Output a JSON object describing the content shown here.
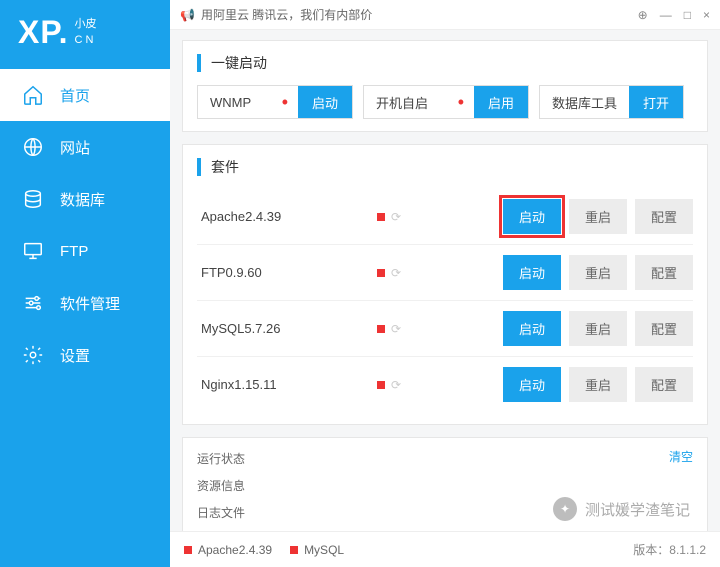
{
  "logo": {
    "main": "XP.",
    "sub1": "小皮",
    "sub2": "C N"
  },
  "topbar": {
    "announce": "用阿里云 腾讯云，我们有内部价",
    "pin": "⊕",
    "min": "—",
    "max": "□",
    "close": "×"
  },
  "sidebar": {
    "items": [
      {
        "label": "首页"
      },
      {
        "label": "网站"
      },
      {
        "label": "数据库"
      },
      {
        "label": "FTP"
      },
      {
        "label": "软件管理"
      },
      {
        "label": "设置"
      }
    ]
  },
  "quick": {
    "title": "一键启动",
    "wnmp": {
      "label": "WNMP",
      "btn": "启动"
    },
    "boot": {
      "label": "开机自启",
      "btn": "启用"
    },
    "db": {
      "label": "数据库工具",
      "btn": "打开"
    }
  },
  "suite": {
    "title": "套件",
    "btn_start": "启动",
    "btn_restart": "重启",
    "btn_config": "配置",
    "rows": [
      {
        "name": "Apache2.4.39"
      },
      {
        "name": "FTP0.9.60"
      },
      {
        "name": "MySQL5.7.26"
      },
      {
        "name": "Nginx1.15.11"
      }
    ]
  },
  "panel": {
    "tabs": [
      "运行状态",
      "资源信息",
      "日志文件"
    ],
    "clear": "清空"
  },
  "footer": {
    "items": [
      "Apache2.4.39",
      "MySQL"
    ],
    "version_label": "版本：",
    "version": "8.1.1.2"
  },
  "watermark": "测试媛学渣笔记"
}
